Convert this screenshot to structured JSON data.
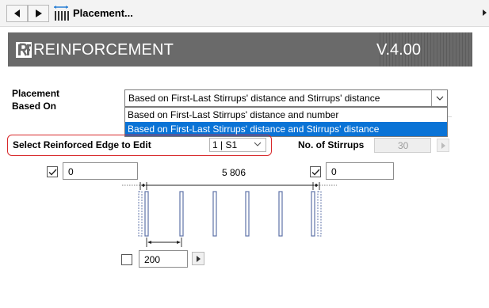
{
  "titlebar": {
    "title": "Placement...",
    "back_icon": "triangle-left-icon",
    "forward_icon": "triangle-right-icon",
    "panel_icon": "stirrup-placement-icon"
  },
  "banner": {
    "title": "REINFORCEMENT",
    "version": "V.4.00",
    "logo_icon": "rf-logo-icon",
    "background": "#6a6a6a"
  },
  "placement": {
    "label_line1": "Placement",
    "label_line2": "Based On",
    "selected": "Based on First-Last Stirrups' distance and Stirrups' distance",
    "options": [
      "Based on First-Last Stirrups' distance and number",
      "Based on First-Last Stirrups' distance and Stirrups' distance"
    ],
    "highlight_color": "#0a73d6"
  },
  "edge": {
    "label": "Select Reinforced Edge to Edit",
    "value": "1 | S1",
    "highlight_color": "#d8292b"
  },
  "stirrups": {
    "label": "No. of Stirrups",
    "value": "30"
  },
  "distances": {
    "first_checked": true,
    "first_value": "0",
    "total": "5 806",
    "last_checked": true,
    "last_value": "0",
    "spacing_checked": false,
    "spacing_value": "200"
  }
}
